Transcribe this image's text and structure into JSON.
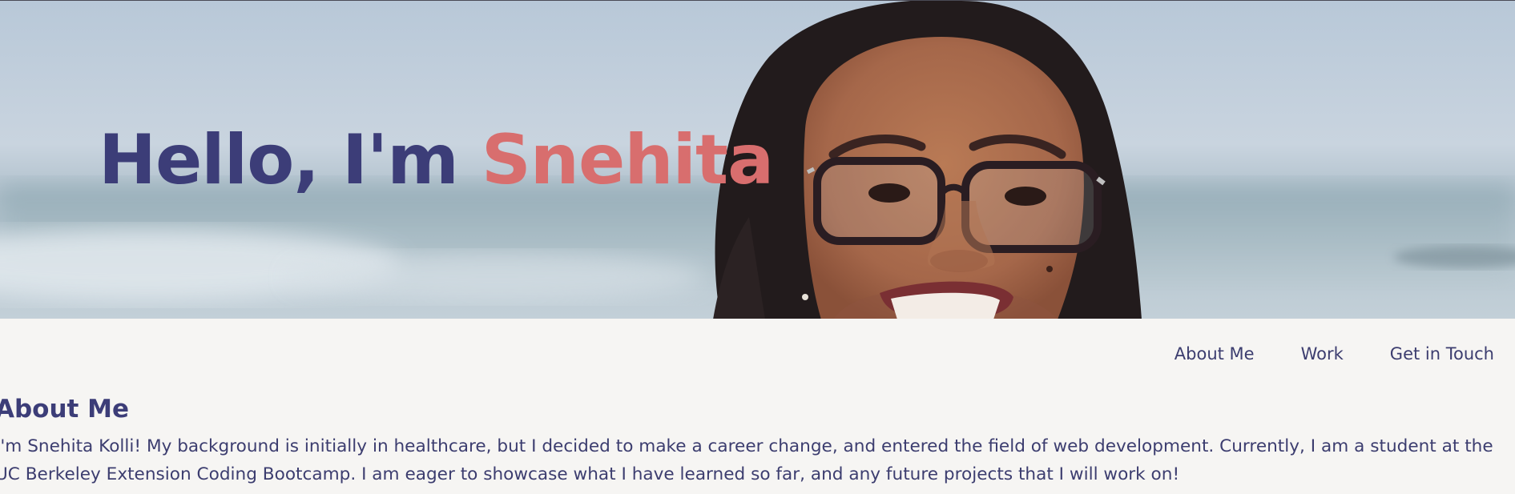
{
  "hero": {
    "greeting": "Hello, I'm ",
    "name": "Snehita",
    "photo_alt": "portrait-photo"
  },
  "nav": {
    "items": [
      {
        "label": "About Me"
      },
      {
        "label": "Work"
      },
      {
        "label": "Get in Touch"
      }
    ]
  },
  "about": {
    "heading": "About Me",
    "body": "I'm Snehita Kolli! My background is initially in healthcare, but I decided to make a career change, and entered the field of web development. Currently, I am a student at the UC Berkeley Extension Coding Bootcamp. I am eager to showcase what I have learned so far, and any future projects that I will work on!"
  },
  "colors": {
    "primary": "#3c3d78",
    "accent": "#d86e6e",
    "background": "#f6f5f3"
  }
}
